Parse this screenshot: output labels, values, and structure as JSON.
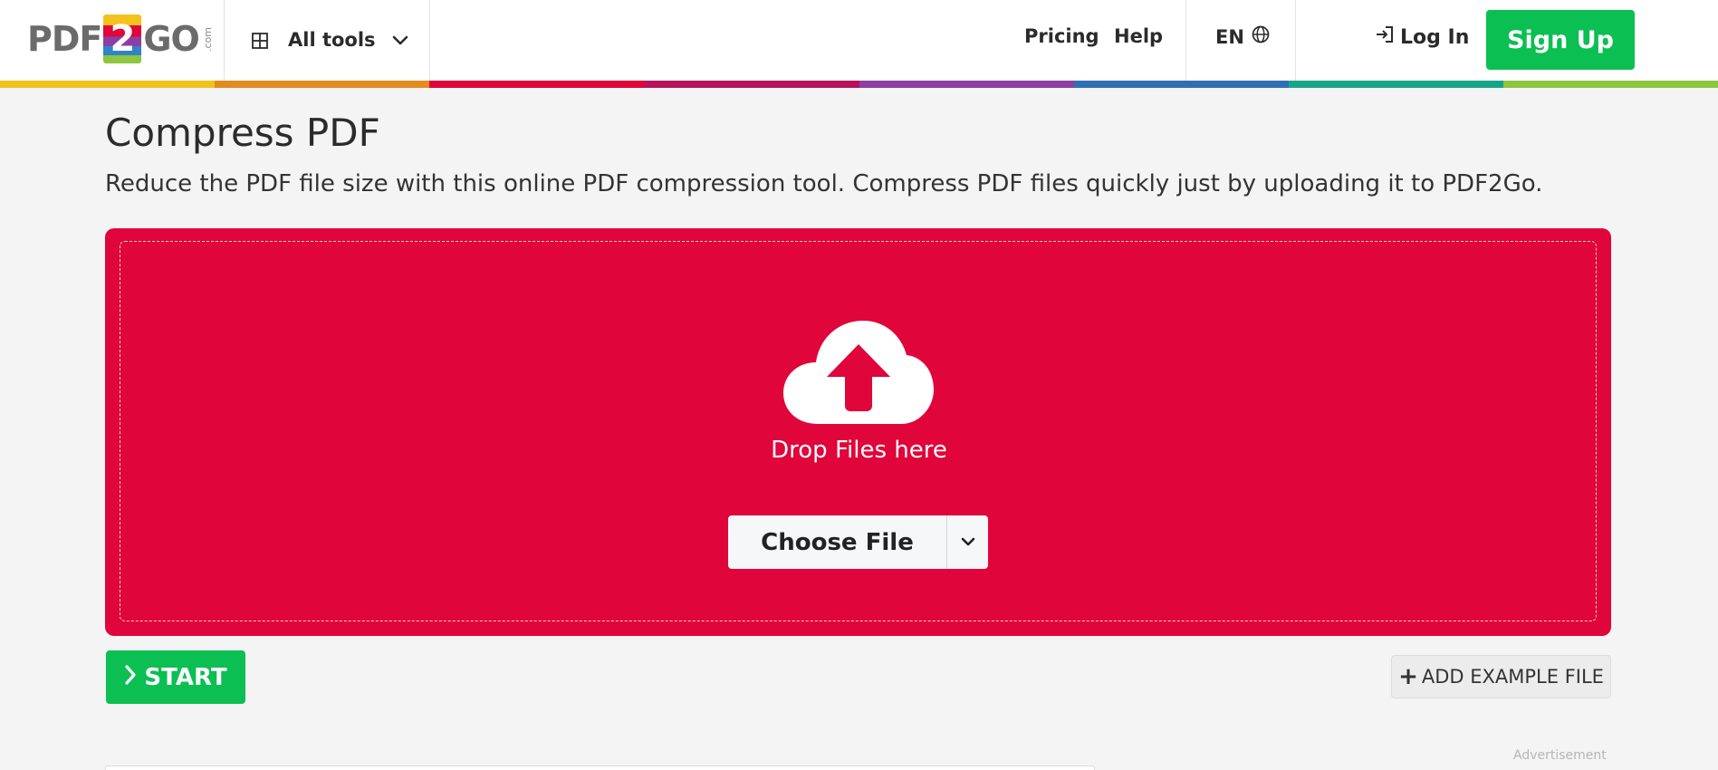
{
  "header": {
    "logo": {
      "left": "PDF",
      "mid": "2",
      "right": "GO",
      "suffix": ".com"
    },
    "all_tools_label": "All tools",
    "nav": {
      "pricing": "Pricing",
      "help": "Help"
    },
    "language": "EN",
    "login_label": "Log In",
    "signup_label": "Sign Up",
    "colorbar": [
      "#f0c21b",
      "#e28b1e",
      "#e0053a",
      "#b8125c",
      "#8c3ea3",
      "#2f6fb3",
      "#17a589",
      "#8dc63f"
    ]
  },
  "main": {
    "title": "Compress PDF",
    "subtitle": "Reduce the PDF file size with this online PDF compression tool. Compress PDF files quickly just by uploading it to PDF2Go.",
    "dropzone": {
      "text": "Drop Files here",
      "choose_file_label": "Choose File",
      "color": "#e0053a"
    },
    "start_label": "START",
    "add_example_label": "ADD EXAMPLE FILE",
    "advertisement_label": "Advertisement"
  },
  "icons": [
    "grid-icon",
    "chevron-down-icon",
    "globe-icon",
    "login-icon",
    "cloud-upload-icon",
    "chevron-right-icon",
    "plus-icon"
  ]
}
